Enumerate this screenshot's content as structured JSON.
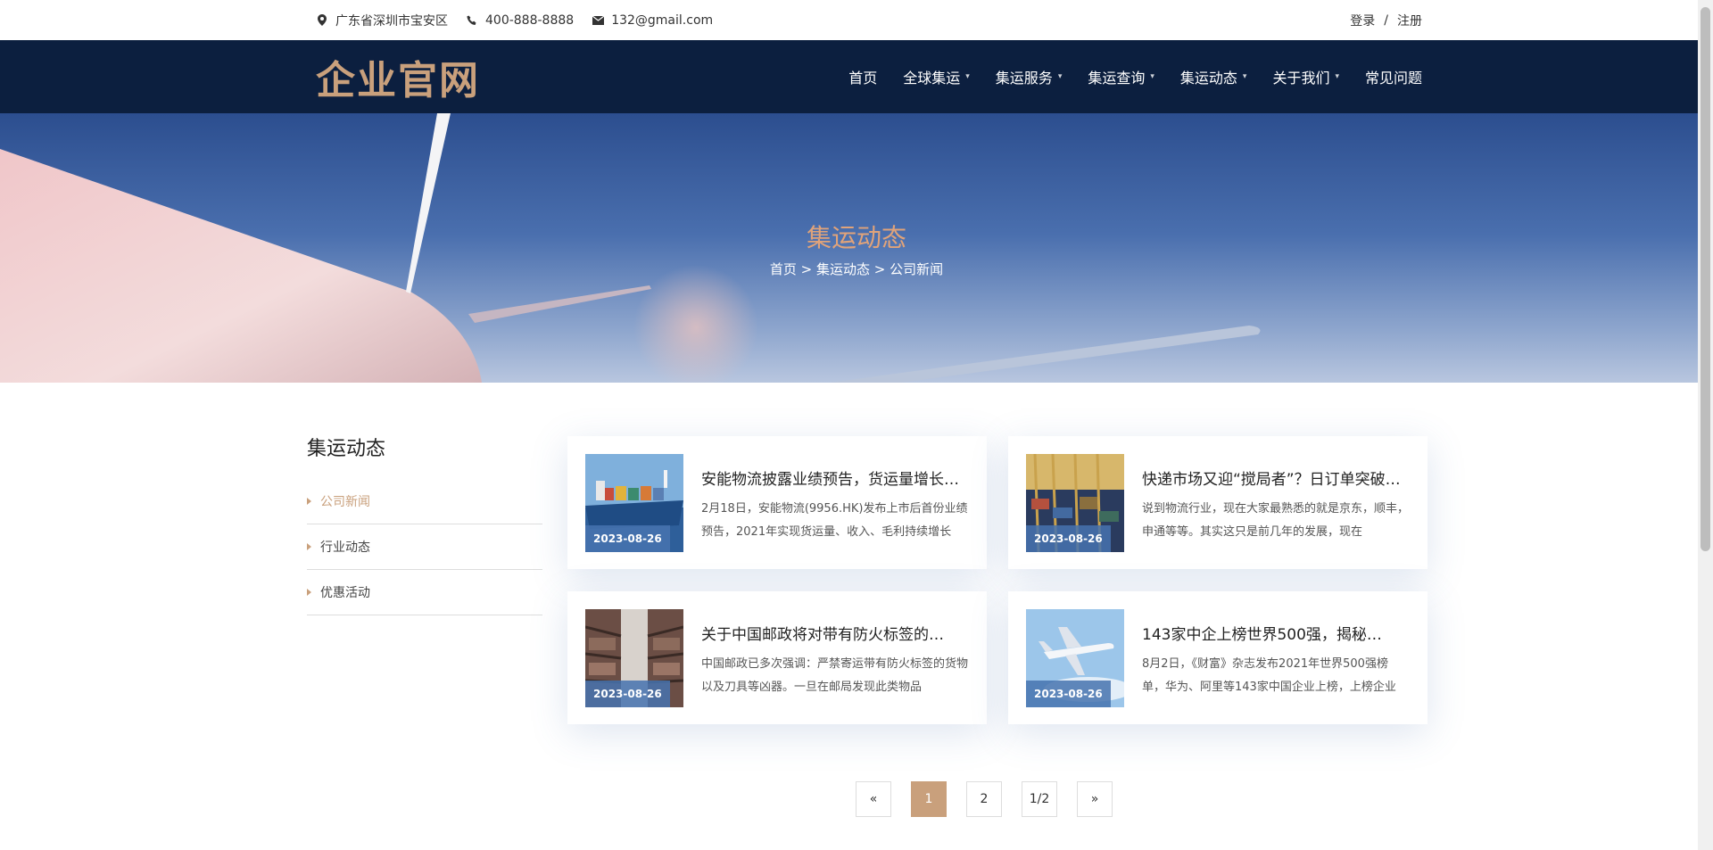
{
  "topbar": {
    "address": "广东省深圳市宝安区",
    "phone": "400-888-8888",
    "email": "132@gmail.com",
    "login": "登录",
    "separator": "/",
    "register": "注册"
  },
  "nav": {
    "logo": "企业官网",
    "items": [
      {
        "label": "首页",
        "dropdown": false
      },
      {
        "label": "全球集运",
        "dropdown": true
      },
      {
        "label": "集运服务",
        "dropdown": true
      },
      {
        "label": "集运查询",
        "dropdown": true
      },
      {
        "label": "集运动态",
        "dropdown": true
      },
      {
        "label": "关于我们",
        "dropdown": true
      },
      {
        "label": "常见问题",
        "dropdown": false
      }
    ],
    "caret": "⌄"
  },
  "banner": {
    "title": "集运动态",
    "breadcrumb": {
      "home": "首页",
      "sep1": ">",
      "section": "集运动态",
      "sep2": ">",
      "current": "公司新闻"
    }
  },
  "sidebar": {
    "title": "集运动态",
    "items": [
      {
        "label": "公司新闻",
        "active": true
      },
      {
        "label": "行业动态",
        "active": false
      },
      {
        "label": "优惠活动",
        "active": false
      }
    ]
  },
  "news": [
    {
      "date": "2023-08-26",
      "title": "安能物流披露业绩预告，货运量增长…",
      "desc": "2月18日，安能物流(9956.HK)发布上市后首份业绩预告，2021年实现货运量、收入、毛利持续增长",
      "image": "container-ship"
    },
    {
      "date": "2023-08-26",
      "title": "快递市场又迎“搅局者”？日订单突破…",
      "desc": "说到物流行业，现在大家最熟悉的就是京东，顺丰，申通等等。其实这只是前几年的发展，现在",
      "image": "port-cranes"
    },
    {
      "date": "2023-08-26",
      "title": "关于中国邮政将对带有防火标签的…",
      "desc": "中国邮政已多次强调：严禁寄运带有防火标签的货物以及刀具等凶器。一旦在邮局发现此类物品",
      "image": "warehouse"
    },
    {
      "date": "2023-08-26",
      "title": "143家中企上榜世界500强，揭秘…",
      "desc": "8月2日，《财富》杂志发布2021年世界500强榜单，华为、阿里等143家中国企业上榜，上榜企业",
      "image": "airplane"
    }
  ],
  "pagination": {
    "prev": "«",
    "pages": [
      "1",
      "2"
    ],
    "current": "1",
    "info": "1/2",
    "next": "»"
  },
  "colors": {
    "navy": "#0c1f3f",
    "gold": "#c9a07c",
    "date_badge": "#4673af"
  }
}
